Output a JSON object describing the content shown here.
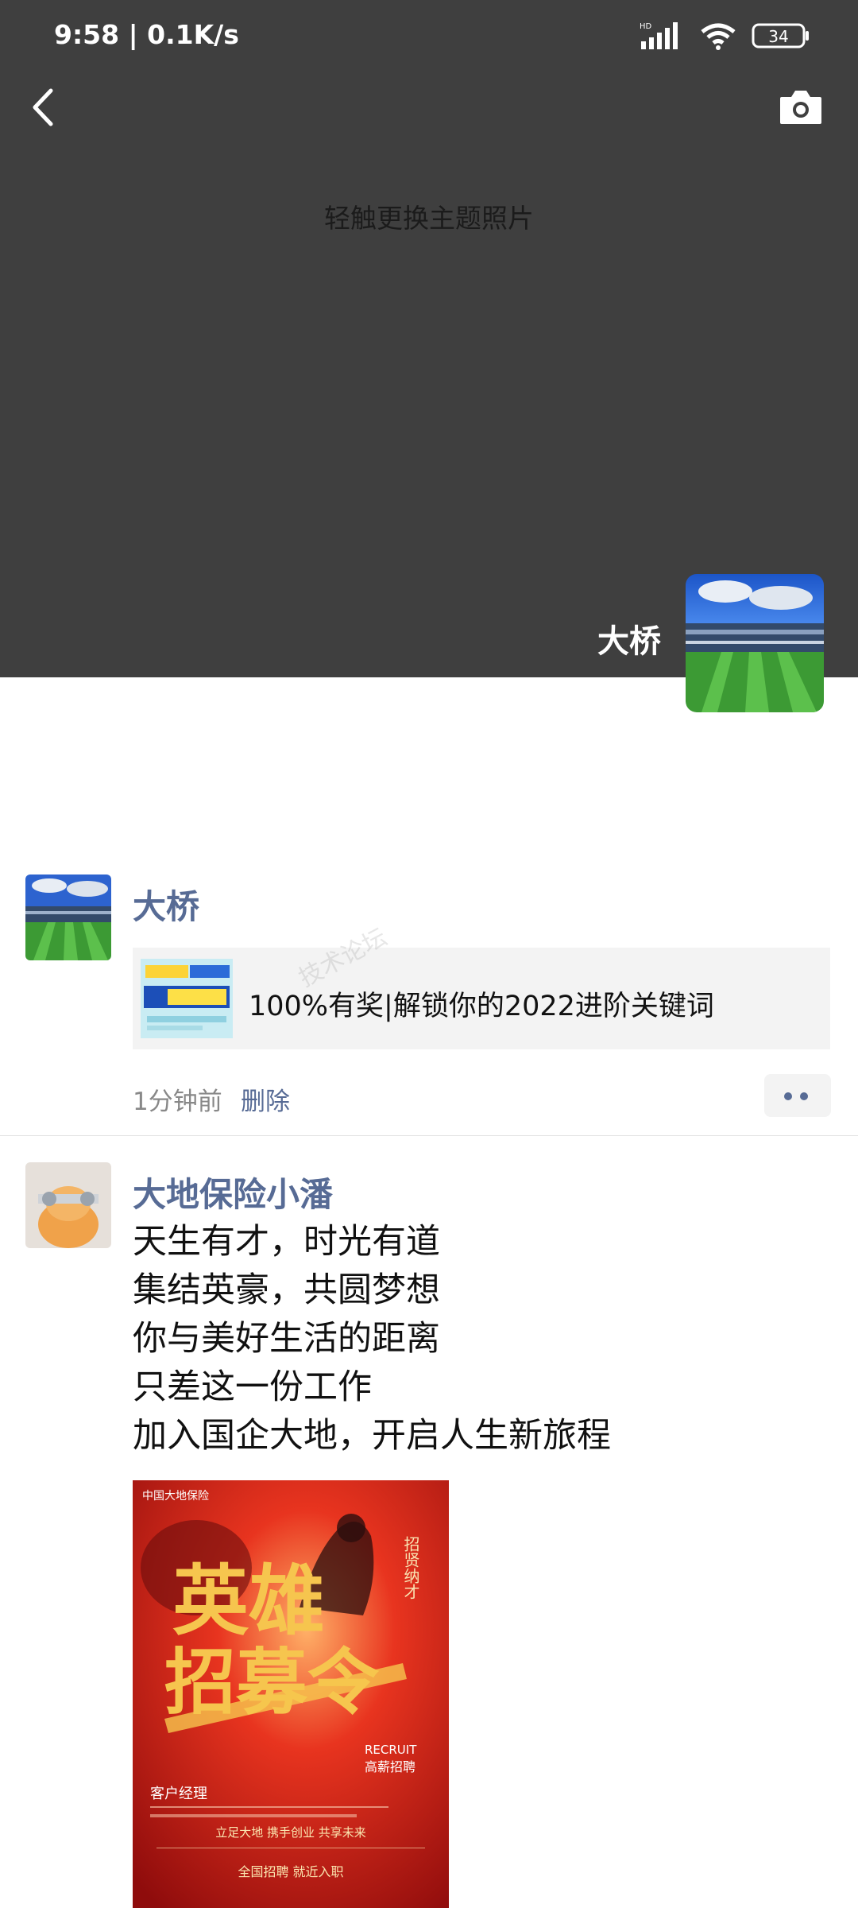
{
  "status_bar": {
    "time_speed": "9:58 | 0.1K/s",
    "battery": "34",
    "network": "HD"
  },
  "cover": {
    "hint": "轻触更换主题照片",
    "user_name": "大桥"
  },
  "posts": [
    {
      "user": "大桥",
      "share_title": "100%有奖|解锁你的2022进阶关键词",
      "time": "1分钟前",
      "delete_label": "删除"
    },
    {
      "user": "大地保险小潘",
      "lines": [
        "天生有才，时光有道",
        "集结英豪，共圆梦想",
        "你与美好生活的距离",
        "只差这一份工作",
        "加入国企大地，开启人生新旅程"
      ],
      "poster": {
        "company": "中国大地保险",
        "headline1": "英雄",
        "headline2": "招募令",
        "side_text": "招贤纳才",
        "recruit": "RECRUIT",
        "recruit_cn": "高薪招聘",
        "role": "客户经理",
        "slogan": "立足大地 携手创业 共享未来",
        "footer": "全国招聘 就近入职"
      }
    }
  ],
  "watermark": "技术论坛"
}
